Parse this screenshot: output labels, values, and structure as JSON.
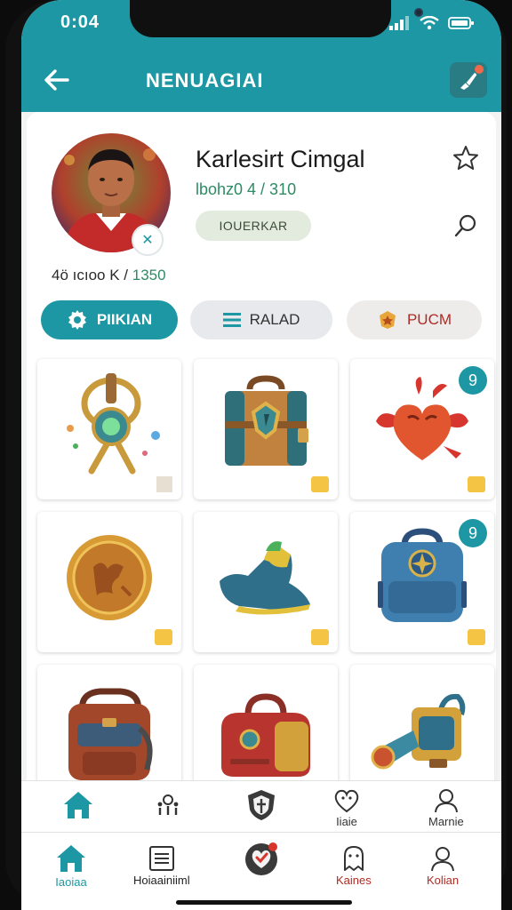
{
  "status_bar": {
    "time": "0:04"
  },
  "header": {
    "title": "NENUAGIAI",
    "back_icon": "arrow-left-icon",
    "action_icon": "brush-icon"
  },
  "profile": {
    "name": "Karlesirt Cimgal",
    "subtitle": "lbohz0 4 / 310",
    "tag": "IOUERKAR",
    "stats_prefix": "4ö ıcıoo K /",
    "stats_value": "1350"
  },
  "filters": [
    {
      "label": "PIIKIAN",
      "icon": "gear-icon",
      "active": true
    },
    {
      "label": "RALAD",
      "icon": "list-icon",
      "active": false
    },
    {
      "label": "PUCM",
      "icon": "badge-icon",
      "active": false
    }
  ],
  "items": [
    {
      "name": "magic-orb-staff",
      "badge": ""
    },
    {
      "name": "treasure-chest",
      "badge": ""
    },
    {
      "name": "heart-creature",
      "badge": "9"
    },
    {
      "name": "gold-coin",
      "badge": ""
    },
    {
      "name": "boot",
      "badge": ""
    },
    {
      "name": "backpack-blue",
      "badge": "9"
    },
    {
      "name": "backpack-brown",
      "badge": ""
    },
    {
      "name": "travel-bag",
      "badge": ""
    },
    {
      "name": "telescope",
      "badge": ""
    }
  ],
  "nav_top": [
    {
      "icon": "home-icon",
      "label": ""
    },
    {
      "icon": "people-icon",
      "label": ""
    },
    {
      "icon": "shield-icon",
      "label": ""
    },
    {
      "icon": "heart-face-icon",
      "label": "Iiaie"
    },
    {
      "icon": "person-icon",
      "label": "Marnie"
    }
  ],
  "nav_bottom": [
    {
      "icon": "home-icon",
      "label": "Iaoiaa"
    },
    {
      "icon": "document-icon",
      "label": "Hoiaainiiml"
    },
    {
      "icon": "heart-check-icon",
      "label": ""
    },
    {
      "icon": "ghost-icon",
      "label": "Kaines"
    },
    {
      "icon": "person-icon",
      "label": "Kolian"
    }
  ],
  "colors": {
    "accent": "#1d97a3",
    "tag_bg": "#e3ebde",
    "danger": "#b02b23"
  }
}
